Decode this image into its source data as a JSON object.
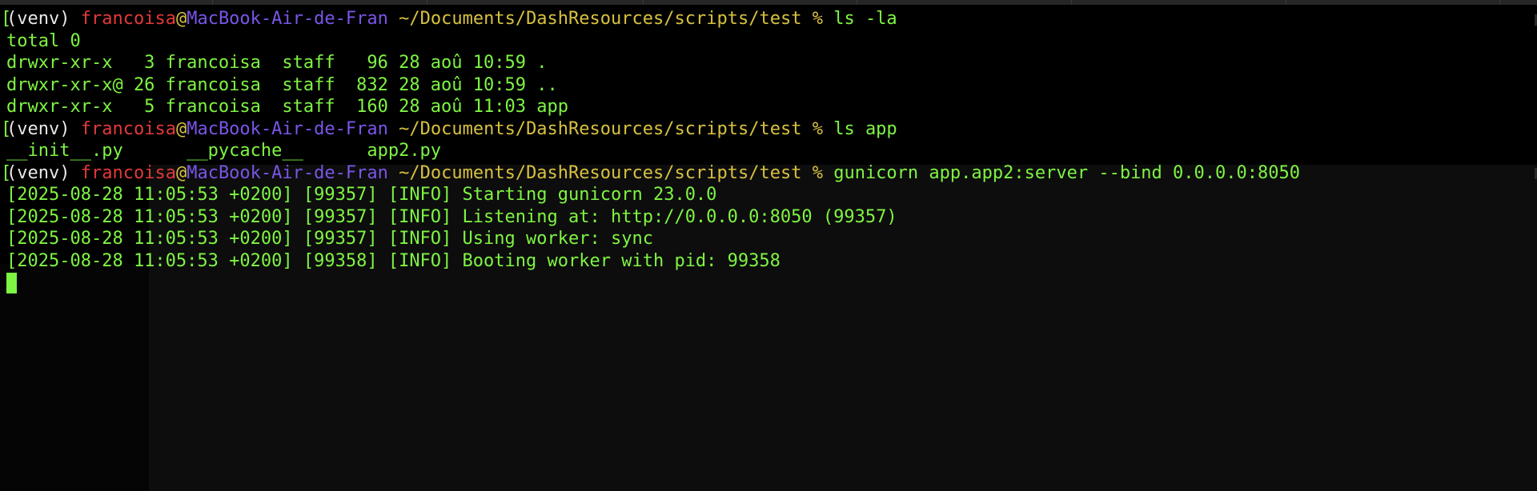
{
  "terminal": {
    "colors": {
      "background": "#000000",
      "venv": "#e9e9e9",
      "user": "#e2393b",
      "host": "#7a55e8",
      "path": "#d8c140",
      "output": "#7ef542"
    },
    "prompt": {
      "venv": "(venv)",
      "user": "francoisa",
      "at": "@",
      "host": "MacBook-Air-de-Fran",
      "path": "~/Documents/DashResources/scripts/test",
      "symbol": "%"
    },
    "commands": [
      "ls -la",
      "ls app",
      "gunicorn app.app2:server --bind 0.0.0.0:8050"
    ],
    "ls_la_output": [
      "total 0",
      "drwxr-xr-x   3 francoisa  staff   96 28 aoû 10:59 .",
      "drwxr-xr-x@ 26 francoisa  staff  832 28 aoû 10:59 ..",
      "drwxr-xr-x   5 francoisa  staff  160 28 aoû 11:03 app"
    ],
    "ls_app_output": "__init__.py      __pycache__      app2.py",
    "gunicorn_output": [
      "[2025-08-28 11:05:53 +0200] [99357] [INFO] Starting gunicorn 23.0.0",
      "[2025-08-28 11:05:53 +0200] [99357] [INFO] Listening at: http://0.0.0.0:8050 (99357)",
      "[2025-08-28 11:05:53 +0200] [99357] [INFO] Using worker: sync",
      "[2025-08-28 11:05:53 +0200] [99358] [INFO] Booting worker with pid: 99358"
    ]
  }
}
